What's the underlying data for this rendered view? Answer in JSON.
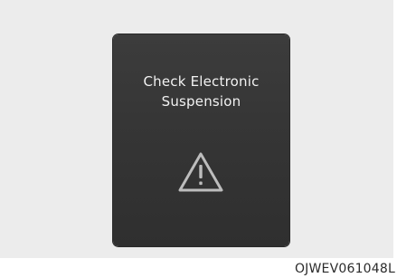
{
  "display": {
    "message_line1": "Check Electronic",
    "message_line2": "Suspension",
    "icon": "warning-triangle-icon"
  },
  "caption": "OJWEV061048L",
  "colors": {
    "background": "#ececec",
    "panel": "#363636",
    "text": "#f2f2f2",
    "icon": "#bdbdbd"
  }
}
